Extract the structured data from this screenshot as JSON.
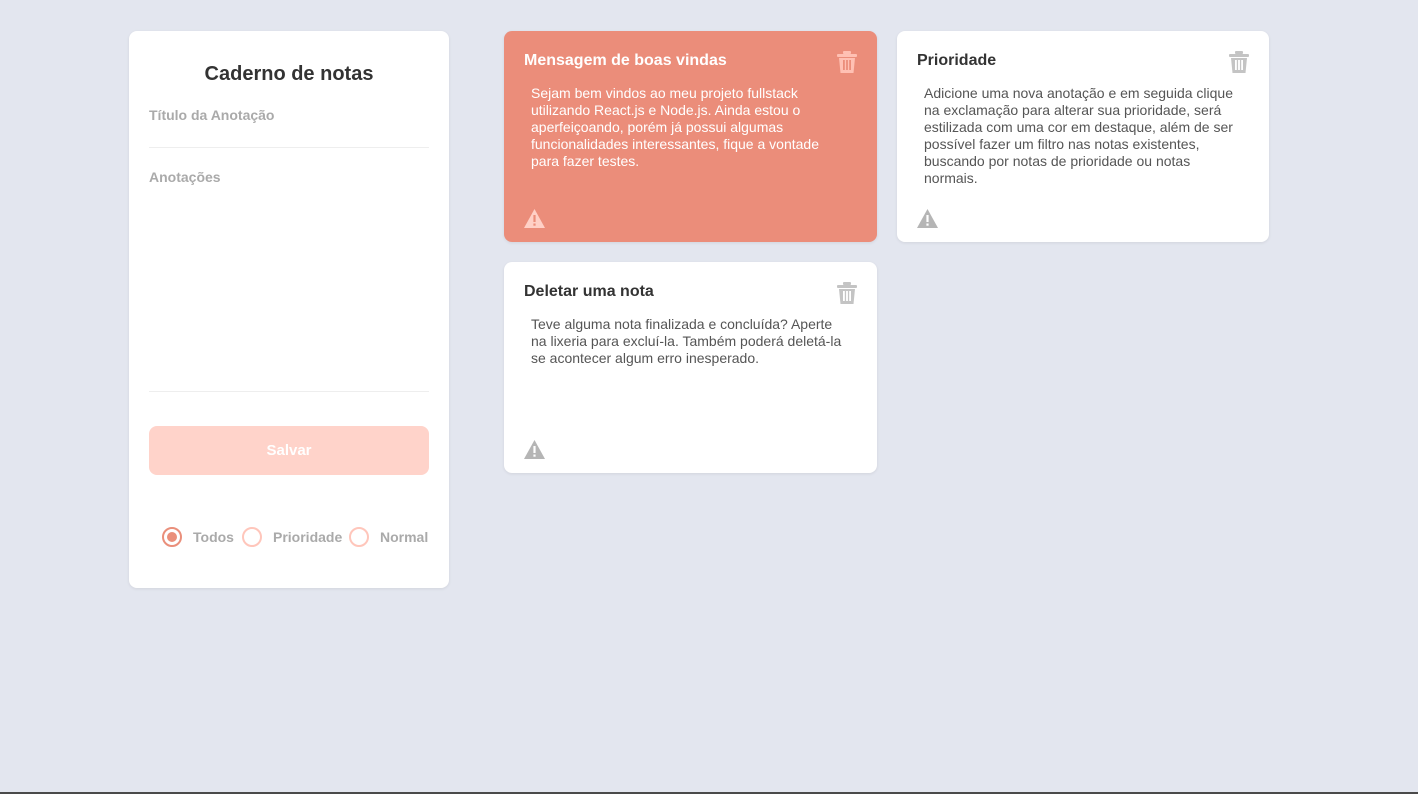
{
  "form": {
    "title": "Caderno de notas",
    "title_field_label": "Título da Anotação",
    "notes_field_label": "Anotações",
    "save_label": "Salvar",
    "filters": [
      {
        "label": "Todos",
        "checked": true
      },
      {
        "label": "Prioridade",
        "checked": false
      },
      {
        "label": "Normal",
        "checked": false
      }
    ]
  },
  "notes": [
    {
      "title": "Mensagem de boas vindas",
      "body": "Sejam bem vindos ao meu projeto fullstack utilizando React.js e Node.js. Ainda estou o aperfeiçoando, porém já possui algumas funcionalidades interessantes, fique a vontade para fazer testes.",
      "priority": true
    },
    {
      "title": "Prioridade",
      "body": "Adicione uma nova anotação e em seguida clique na exclamação para alterar sua prioridade, será estilizada com uma cor em destaque, além de ser possível fazer um filtro nas notas existentes, buscando por notas de prioridade ou notas normais.",
      "priority": false
    },
    {
      "title": "Deletar uma nota",
      "body": "Teve alguma nota finalizada e concluída? Aperte na lixeria para excluí-la. Também poderá deletá-la se acontecer algum erro inesperado.",
      "priority": false
    }
  ],
  "icons": {
    "delete": "trash-icon",
    "priority_toggle": "warning-icon"
  },
  "colors": {
    "background": "#e3e6ef",
    "accent": "#eb8d7a",
    "button_disabled": "#ffd3ca"
  }
}
